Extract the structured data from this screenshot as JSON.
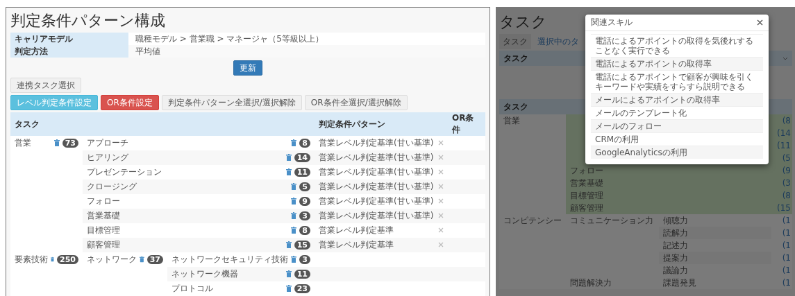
{
  "left_panel": {
    "title": "判定条件パターン構成",
    "info": [
      {
        "label": "キャリアモデル",
        "value": "職種モデル > 営業職 > マネージャ（5等級以上）"
      },
      {
        "label": "判定方法",
        "value": "平均値"
      }
    ],
    "update_button": "更新",
    "link_task_button": "連携タスク選択",
    "actions": [
      {
        "label": "レベル判定条件設定",
        "kind": "info"
      },
      {
        "label": "OR条件設定",
        "kind": "danger"
      },
      {
        "label": "判定条件パターン全選択/選択解除",
        "kind": "default"
      },
      {
        "label": "OR条件全選択/選択解除",
        "kind": "default"
      }
    ],
    "table": {
      "columns": [
        "タスク",
        "判定条件パターン",
        "OR条件"
      ],
      "groups": [
        {
          "name": "営業",
          "count": "73",
          "children": [
            {
              "name": "アプローチ",
              "count": "8",
              "pattern": "営業レベル判定基準(甘い基準)"
            },
            {
              "name": "ヒアリング",
              "count": "14",
              "pattern": "営業レベル判定基準(甘い基準)"
            },
            {
              "name": "プレゼンテーション",
              "count": "11",
              "pattern": "営業レベル判定基準(甘い基準)"
            },
            {
              "name": "クロージング",
              "count": "5",
              "pattern": "営業レベル判定基準(甘い基準)"
            },
            {
              "name": "フォロー",
              "count": "9",
              "pattern": "営業レベル判定基準(甘い基準)"
            },
            {
              "name": "営業基礎",
              "count": "3",
              "pattern": "営業レベル判定基準(甘い基準)"
            },
            {
              "name": "目標管理",
              "count": "8",
              "pattern": "営業レベル判定基準"
            },
            {
              "name": "顧客管理",
              "count": "15",
              "pattern": "営業レベル判定基準"
            }
          ]
        },
        {
          "name": "要素技術",
          "count": "250",
          "children": [
            {
              "name": "ネットワーク",
              "count": "37",
              "children": [
                {
                  "name": "ネットワークセキュリティ技術",
                  "count": "3"
                },
                {
                  "name": "ネットワーク機器",
                  "count": "11"
                },
                {
                  "name": "プロトコル",
                  "count": "23"
                }
              ]
            }
          ]
        }
      ]
    }
  },
  "right_panel": {
    "title": "タスク",
    "tabs": [
      {
        "label": "タスク",
        "selected": true
      },
      {
        "label": "選択中のタ",
        "selected": false
      }
    ],
    "table_header": "タスク",
    "section_header": "タスク",
    "groups": [
      {
        "name": "営業",
        "highlighted": true,
        "children": [
          {
            "count": "(8"
          },
          {
            "count": "(14"
          },
          {
            "count": "(11"
          },
          {
            "count": "(5"
          },
          {
            "name": "フォロー",
            "count": "(9"
          },
          {
            "name": "営業基礎",
            "count": "(3"
          },
          {
            "name": "目標管理",
            "count": "(8"
          },
          {
            "name": "顧客管理",
            "count": "(15"
          }
        ]
      },
      {
        "name": "コンピテンシー",
        "highlighted": false,
        "children": [
          {
            "name": "コミュニケーション力",
            "children": [
              {
                "name": "傾聴力",
                "count": "(1"
              },
              {
                "name": "読解力",
                "count": "(1"
              },
              {
                "name": "記述力",
                "count": "(1"
              },
              {
                "name": "提案力",
                "count": "(1"
              },
              {
                "name": "議論力",
                "count": "(1"
              }
            ]
          },
          {
            "name": "問題解決力",
            "children": [
              {
                "name": "課題発見",
                "count": "(1"
              }
            ]
          }
        ]
      }
    ]
  },
  "modal": {
    "title": "関連スキル",
    "items": [
      "電話によるアポイントの取得を気後れすることなく実行できる",
      "電話によるアポイントの取得率",
      "電話によるアポイントで顧客が興味を引くキーワードや実績をすらすら説明できる",
      "メールによるアポイントの取得率",
      "メールのテンプレート化",
      "メールのフォロー",
      "CRMの利用",
      "GoogleAnalyticsの利用"
    ]
  }
}
